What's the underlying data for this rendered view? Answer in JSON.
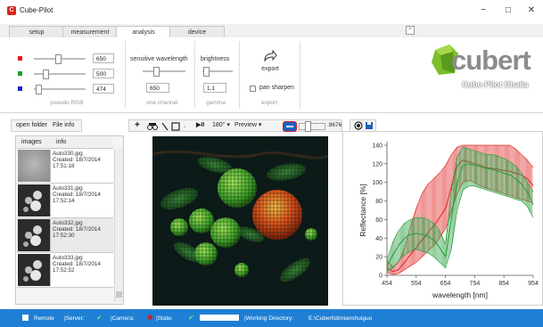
{
  "app": {
    "title": "Cube-Pilot",
    "icon_letter": "C"
  },
  "window_buttons": {
    "minimize": "−",
    "maximize": "□",
    "close": "✕"
  },
  "tabs": [
    {
      "label": "setup"
    },
    {
      "label": "measurement"
    },
    {
      "label": "analysis"
    },
    {
      "label": "device"
    }
  ],
  "collapse_glyph": "^",
  "ribbon": {
    "pseudo_rgb": {
      "group_label": "pseudo RGB",
      "red_value": "650",
      "green_value": "500",
      "blue_value": "474",
      "colors": {
        "red": "#e8141b",
        "green": "#1aa12a",
        "blue": "#1f22d6"
      }
    },
    "one_channel": {
      "title": "sensitive wavelength",
      "value": "650",
      "group_label": "one channel"
    },
    "gamma": {
      "title": "brightness",
      "value": "1.1",
      "group_label": "gamma"
    },
    "export": {
      "button_label": "export",
      "pan_sharpen_label": "pan sharpen",
      "group_label": "export"
    },
    "logo": {
      "brand": "cubert",
      "subtitle": "Cube-Pilot Dhalia"
    }
  },
  "left_panel": {
    "toolbar": {
      "open_folder": "open folder",
      "file_info": "File info"
    },
    "headers": {
      "images": "images",
      "info": "info"
    },
    "files": [
      {
        "name": "Auto330.jpg",
        "created": "Created: 18/7/2014",
        "time": "17:51:18"
      },
      {
        "name": "Auto331.jpg",
        "created": "Created: 18/7/2014",
        "time": "17:52:14"
      },
      {
        "name": "Auto332.jpg",
        "created": "Created: 18/7/2014",
        "time": "17:52:30"
      },
      {
        "name": "Auto333.jpg",
        "created": "Created: 18/7/2014",
        "time": "17:52:52"
      }
    ]
  },
  "image_toolbar": {
    "rotation": "180°",
    "preview": "Preview",
    "opacity_value": ".9676"
  },
  "chart_data": {
    "type": "area",
    "xlabel": "wavelength [nm]",
    "ylabel": "Reflectance [%]",
    "xlim": [
      454,
      954
    ],
    "ylim": [
      0,
      140
    ],
    "xticks": [
      454,
      554,
      654,
      754,
      854,
      954
    ],
    "yticks": [
      0,
      20,
      40,
      60,
      80,
      100,
      120,
      140
    ],
    "x": [
      454,
      474,
      494,
      514,
      534,
      554,
      574,
      594,
      614,
      634,
      654,
      674,
      694,
      714,
      734,
      754,
      774,
      794,
      814,
      834,
      854,
      874,
      894,
      914,
      934,
      954
    ],
    "series": [
      {
        "color": "#e03030",
        "mean": [
          8,
          4,
          6,
          14,
          22,
          30,
          38,
          46,
          53,
          62,
          72,
          95,
          118,
          124,
          122,
          120,
          118,
          116,
          115,
          114,
          113,
          112,
          110,
          108,
          104,
          96
        ],
        "upper": [
          16,
          9,
          14,
          30,
          52,
          72,
          88,
          98,
          104,
          110,
          118,
          130,
          138,
          140,
          140,
          140,
          140,
          140,
          140,
          140,
          140,
          140,
          136,
          130,
          124,
          116
        ],
        "lower": [
          3,
          1,
          2,
          6,
          10,
          14,
          20,
          26,
          32,
          40,
          50,
          68,
          88,
          100,
          102,
          100,
          96,
          94,
          92,
          90,
          88,
          86,
          84,
          82,
          80,
          78
        ]
      },
      {
        "color": "#2ea043",
        "mean": [
          10,
          22,
          32,
          40,
          44,
          45,
          44,
          42,
          38,
          30,
          20,
          60,
          100,
          118,
          120,
          118,
          117,
          115,
          114,
          112,
          110,
          108,
          104,
          98,
          90,
          76
        ],
        "upper": [
          16,
          36,
          48,
          56,
          60,
          62,
          62,
          60,
          56,
          48,
          34,
          90,
          128,
          138,
          136,
          134,
          132,
          130,
          130,
          128,
          126,
          122,
          118,
          110,
          100,
          90
        ],
        "lower": [
          4,
          8,
          16,
          22,
          26,
          28,
          26,
          24,
          20,
          14,
          8,
          28,
          70,
          92,
          96,
          96,
          94,
          92,
          90,
          88,
          86,
          84,
          82,
          80,
          74,
          62
        ]
      }
    ]
  },
  "statusbar": {
    "remote": "Remote",
    "server": "|Server:",
    "camera": "|Camera:",
    "state": "|State:",
    "working_dir_label": "|Working Directory:",
    "working_dir": "E:\\Cubert\\dimianshuiguo"
  }
}
